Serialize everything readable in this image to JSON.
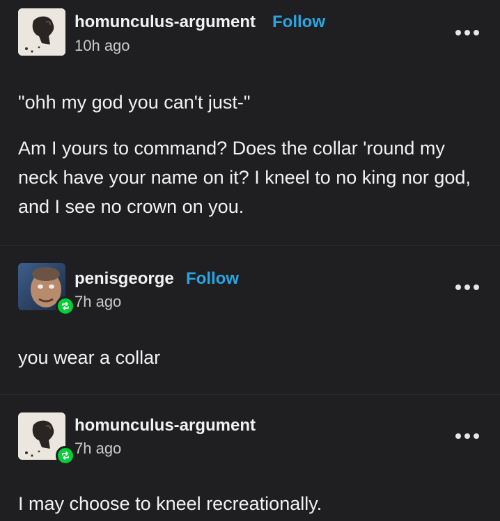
{
  "posts": [
    {
      "username": "homunculus-argument",
      "follow_label": "Follow",
      "time": "10h ago",
      "more_icon": "more-horizontal-icon",
      "paragraphs": [
        "\"ohh my god you can't just-\"",
        "Am I yours to command? Does the collar 'round my neck have your name on it? I kneel to no king nor god, and I see no crown on you."
      ]
    },
    {
      "username": "penisgeorge",
      "follow_label": "Follow",
      "time": "7h ago",
      "more_icon": "more-horizontal-icon",
      "badge_icon": "reblog-icon",
      "paragraphs": [
        "you wear a collar"
      ]
    },
    {
      "username": "homunculus-argument",
      "time": "7h ago",
      "more_icon": "more-horizontal-icon",
      "badge_icon": "reblog-icon",
      "paragraphs": [
        "I may choose to kneel recreationally."
      ]
    }
  ],
  "colors": {
    "background": "#1f1f21",
    "text": "#f2f2f2",
    "follow": "#28a6e3",
    "reblog_badge": "#01cf35",
    "divider": "#2e2e31"
  }
}
